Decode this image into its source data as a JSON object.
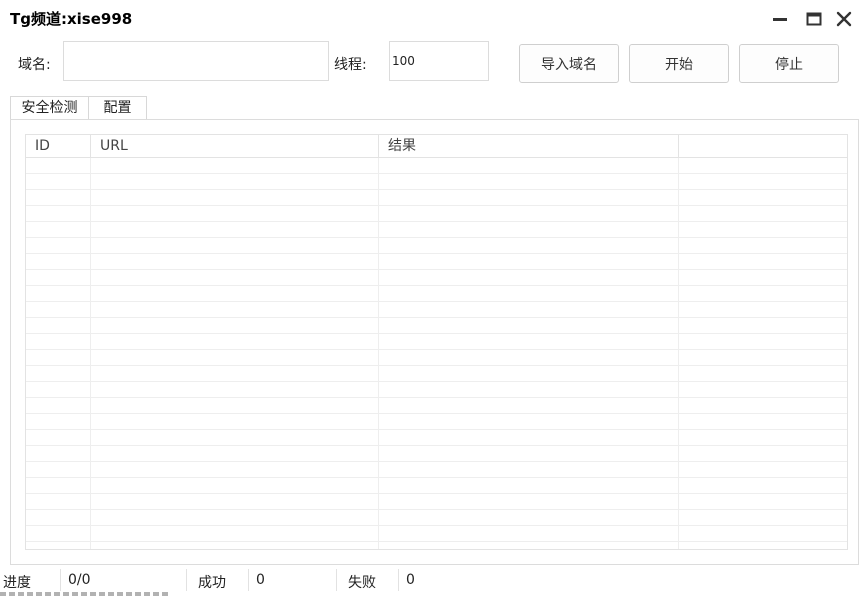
{
  "window": {
    "title": "Tg频道:xise998"
  },
  "form": {
    "domain_label": "域名:",
    "domain_value": "",
    "threads_label": "线程:",
    "threads_value": "100",
    "import_button": "导入域名",
    "start_button": "开始",
    "stop_button": "停止"
  },
  "tabs": [
    {
      "label": "安全检测",
      "active": true
    },
    {
      "label": "配置",
      "active": false
    }
  ],
  "table": {
    "columns": [
      "ID",
      "URL",
      "结果",
      ""
    ],
    "rows": []
  },
  "status": {
    "progress_label": "进度",
    "progress_value": "0/0",
    "success_label": "成功",
    "success_value": "0",
    "fail_label": "失败",
    "fail_value": "0"
  },
  "icons": [
    "minimize-icon",
    "maximize-icon",
    "close-icon"
  ]
}
